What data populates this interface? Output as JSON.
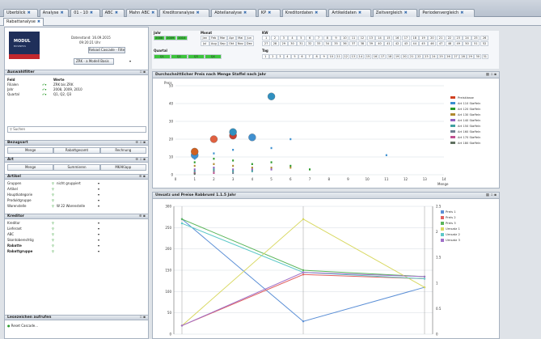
{
  "tabs": [
    {
      "label": "Uberblick"
    },
    {
      "label": "Analyse"
    },
    {
      "label": "01 - 10"
    },
    {
      "label": "ABC"
    },
    {
      "label": "Mahn ABC"
    },
    {
      "label": "Kreditoranalyse"
    },
    {
      "label": "Abteilanalyse"
    },
    {
      "label": "KP"
    },
    {
      "label": "Kreditordaten"
    },
    {
      "label": "Artikeldaten"
    },
    {
      "label": "Zeitvergleich"
    },
    {
      "label": "Periodenvergleich"
    }
  ],
  "subtab": {
    "label": "Rabattanalyse"
  },
  "logo": {
    "line1": "MODUL",
    "line2": "BUSINESS"
  },
  "left": {
    "datinfo": [
      "Datenstand: 16.09.2015",
      "09:20:21 Uhr"
    ],
    "buttons": {
      "reload": "Reload Cascade - Filters",
      "select": "ZRK - a Modell Basis"
    },
    "filter_header": "Auswahlfilter",
    "filter_cols": {
      "feld": "Feld",
      "werte": "Werte"
    },
    "filters": [
      {
        "name": "Filialen",
        "value": "ZRK bis ZRK"
      },
      {
        "name": "Jahr",
        "value": "2008, 2009, 2010"
      },
      {
        "name": "Quartal",
        "value": "Q1, Q2, Q3"
      }
    ],
    "search_placeholder": "Suchen",
    "bezugsart_header": "Bezugsart",
    "bezug_buttons": [
      "Menge",
      "Rabattgesamt",
      "Rechnung"
    ],
    "art_header": "Art",
    "art_buttons": [
      "Menge",
      "Summieren",
      "MKAKiapp"
    ],
    "artikel_header": "Artikel",
    "artikel_rows": [
      {
        "name": "Gruppen",
        "value": "nicht gruppiert"
      },
      {
        "name": "Artikel",
        "value": ""
      },
      {
        "name": "Hauptkategorie",
        "value": ""
      },
      {
        "name": "Produktgruppe",
        "value": ""
      },
      {
        "name": "Warenstelle",
        "value": "W 22 Warenstelle"
      }
    ],
    "kreditor_header": "Kreditor",
    "kreditor_rows": [
      {
        "name": "Kreditor"
      },
      {
        "name": "Lieferant"
      },
      {
        "name": "ABC"
      },
      {
        "name": "Skontoberechtig"
      },
      {
        "name": "Rabatte"
      },
      {
        "name": "Rabattgruppe"
      }
    ],
    "bottom_header": "Lesezeichen aufrufen",
    "bottom_item": "Reset Cascade..."
  },
  "toppanel": {
    "jahr_label": "Jahr",
    "jahr_values": [
      "2008",
      "2009",
      "2010"
    ],
    "monat_label": "Monat",
    "monat_row1": [
      "Jan",
      "Feb",
      "Mar",
      "Apr",
      "Mai",
      "Jun"
    ],
    "monat_row2": [
      "Jul",
      "Aug",
      "Sep",
      "Okt",
      "Nov",
      "Dez"
    ],
    "kw_label": "KW",
    "kw_row1": [
      "1",
      "2",
      "3",
      "4",
      "5",
      "6",
      "7",
      "8",
      "9",
      "10",
      "11",
      "12",
      "13",
      "14",
      "15",
      "16",
      "17",
      "18",
      "19",
      "20",
      "21",
      "22",
      "23",
      "24",
      "25",
      "26"
    ],
    "kw_row2": [
      "27",
      "28",
      "29",
      "30",
      "31",
      "32",
      "33",
      "34",
      "35",
      "36",
      "37",
      "38",
      "39",
      "40",
      "41",
      "42",
      "43",
      "44",
      "45",
      "46",
      "47",
      "48",
      "49",
      "50",
      "51",
      "52"
    ],
    "quartal_label": "Quartal",
    "quartal_values": [
      "Q1",
      "Q2",
      "Q3",
      "Q4"
    ],
    "tag_label": "Tag",
    "tag_values": [
      "1",
      "2",
      "3",
      "4",
      "5",
      "6",
      "7",
      "8",
      "9",
      "10",
      "11",
      "12",
      "13",
      "14",
      "15",
      "16",
      "17",
      "18",
      "19",
      "20",
      "21",
      "22",
      "23",
      "24",
      "25",
      "26",
      "27",
      "28",
      "29",
      "30",
      "31"
    ]
  },
  "colors": {
    "green": "#3cc43c",
    "grid": "#c9d0d8"
  },
  "chart_data": [
    {
      "type": "scatter",
      "title": "Durchschnittlicher Preis nach Menge Staffel nach Jahr",
      "xlabel": "Menge",
      "ylabel": "Preis",
      "xlim": [
        0,
        14
      ],
      "ylim": [
        0,
        50
      ],
      "xticks": [
        "0",
        "1",
        "2",
        "3",
        "4",
        "5",
        "6",
        "7",
        "8",
        "9",
        "10",
        "11",
        "12",
        "13",
        "14"
      ],
      "yticks": [
        "0",
        "10",
        "20",
        "30",
        "40",
        "50"
      ],
      "series": [
        {
          "name": "Preisklasse",
          "points": [
            [
              1,
              11
            ],
            [
              1,
              13
            ],
            [
              2,
              20
            ],
            [
              3,
              22
            ],
            [
              3,
              24
            ],
            [
              4,
              21
            ],
            [
              5,
              44
            ]
          ]
        },
        {
          "name": "Art 110 Staffeln",
          "points": [
            [
              1,
              9
            ],
            [
              2,
              12
            ],
            [
              3,
              14
            ],
            [
              5,
              15
            ],
            [
              6,
              20
            ],
            [
              11,
              11
            ]
          ]
        },
        {
          "name": "Art 120 Staffeln",
          "points": [
            [
              1,
              7
            ],
            [
              2,
              9
            ],
            [
              3,
              8
            ],
            [
              4,
              6
            ],
            [
              5,
              7
            ],
            [
              6,
              5
            ],
            [
              7,
              3
            ]
          ]
        },
        {
          "name": "Art 130 Staffeln",
          "points": [
            [
              1,
              5
            ],
            [
              2,
              6
            ],
            [
              3,
              5
            ],
            [
              4,
              4
            ],
            [
              5,
              4
            ],
            [
              6,
              4
            ]
          ]
        },
        {
          "name": "Art 140 Staffeln",
          "points": [
            [
              1,
              3
            ],
            [
              2,
              4
            ],
            [
              3,
              3
            ],
            [
              4,
              3
            ],
            [
              5,
              3
            ]
          ]
        },
        {
          "name": "Art 150 Staffeln",
          "points": [
            [
              1,
              2
            ],
            [
              2,
              3
            ],
            [
              3,
              2
            ],
            [
              4,
              2
            ]
          ]
        },
        {
          "name": "Art 160 Staffeln",
          "points": [
            [
              1,
              1
            ],
            [
              2,
              2
            ],
            [
              3,
              1
            ]
          ]
        },
        {
          "name": "Art 170 Staffeln",
          "points": [
            [
              1,
              1
            ],
            [
              2,
              1
            ]
          ]
        },
        {
          "name": "Art 180 Staffeln",
          "points": [
            [
              1,
              0.5
            ]
          ]
        }
      ],
      "legend": "right"
    },
    {
      "type": "line",
      "title": "Umsatz und Preise Rabbruml 1.1.5 Jahr",
      "x": [
        "2008",
        "2009",
        "2010"
      ],
      "ylim": [
        0,
        300
      ],
      "yticks": [
        "0",
        "50",
        "100",
        "150",
        "200",
        "250",
        "300"
      ],
      "y2lim": [
        0,
        2.5
      ],
      "y2ticks": [
        "0",
        "0.5",
        "1",
        "1.5",
        "2",
        "2.5"
      ],
      "series": [
        {
          "name": "Preis 1",
          "color": "#5b8fd6",
          "values": [
            270,
            30,
            110
          ]
        },
        {
          "name": "Preis 2",
          "color": "#e06060",
          "values": [
            20,
            140,
            130
          ]
        },
        {
          "name": "Preis 3",
          "color": "#5ab55a",
          "values": [
            270,
            150,
            135
          ]
        },
        {
          "name": "Umsatz 1",
          "color": "#d8d860",
          "values": [
            20,
            270,
            110
          ]
        },
        {
          "name": "Umsatz 2",
          "color": "#5cc8c8",
          "values": [
            260,
            145,
            130
          ]
        },
        {
          "name": "Umsatz 3",
          "color": "#a070c8",
          "values": [
            20,
            145,
            135
          ]
        }
      ],
      "legend": "right"
    }
  ]
}
